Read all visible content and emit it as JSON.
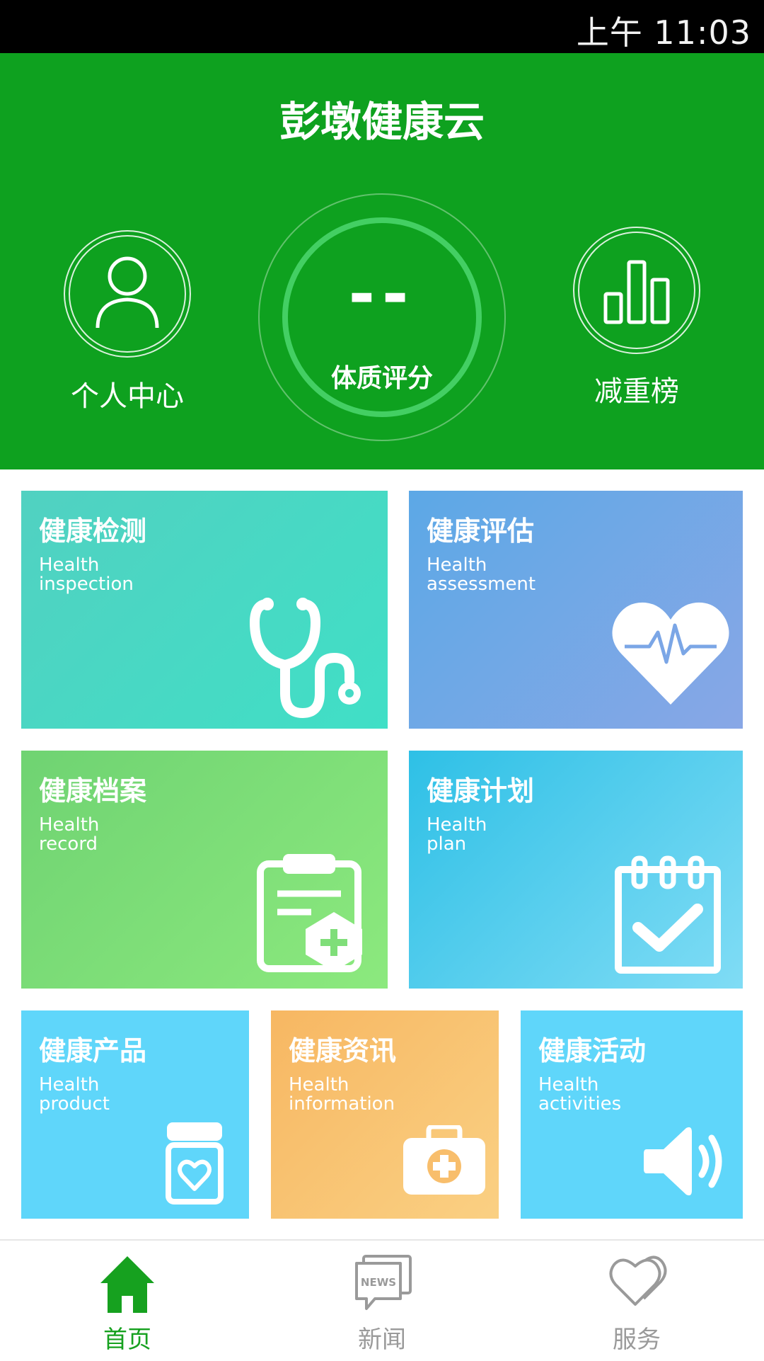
{
  "status_bar": {
    "time": "上午 11:03"
  },
  "header": {
    "app_title": "彭墩健康云",
    "nav": [
      {
        "label": "个人中心",
        "icon": "person-icon"
      },
      {
        "label": "体质评分",
        "value": "--"
      },
      {
        "label": "减重榜",
        "icon": "bar-chart-icon"
      }
    ]
  },
  "tiles": [
    {
      "title": "健康检测",
      "subtitle_line1": "Health",
      "subtitle_line2": "inspection",
      "icon": "stethoscope-icon",
      "colors": [
        "#51d1c1",
        "#40dfc6"
      ]
    },
    {
      "title": "健康评估",
      "subtitle_line1": "Health",
      "subtitle_line2": "assessment",
      "icon": "heart-pulse-icon",
      "colors": [
        "#5ca8e6",
        "#88a7e6"
      ]
    },
    {
      "title": "健康档案",
      "subtitle_line1": "Health",
      "subtitle_line2": "record",
      "icon": "clipboard-plus-icon",
      "colors": [
        "#6fd372",
        "#8ce97e"
      ]
    },
    {
      "title": "健康计划",
      "subtitle_line1": "Health",
      "subtitle_line2": "plan",
      "icon": "calendar-check-icon",
      "colors": [
        "#2ec0e6",
        "#80dcf5"
      ]
    },
    {
      "title": "健康产品",
      "subtitle_line1": "Health",
      "subtitle_line2": "product",
      "icon": "jar-heart-icon",
      "colors": [
        "#5fd6fa",
        "#5fd6fa"
      ]
    },
    {
      "title": "健康资讯",
      "subtitle_line1": "Health",
      "subtitle_line2": "information",
      "icon": "medkit-icon",
      "colors": [
        "#f7b762",
        "#fad083"
      ]
    },
    {
      "title": "健康活动",
      "subtitle_line1": "Health",
      "subtitle_line2": "activities",
      "icon": "speaker-icon",
      "colors": [
        "#5fd6fa",
        "#5fd6fa"
      ]
    }
  ],
  "bottom_nav": {
    "tabs": [
      {
        "label": "首页",
        "icon": "home-icon",
        "active": true
      },
      {
        "label": "新闻",
        "icon": "news-icon",
        "icon_text": "NEWS",
        "active": false
      },
      {
        "label": "服务",
        "icon": "hearts-icon",
        "active": false
      }
    ],
    "active_color": "#16a11f",
    "inactive_color": "#9a9a9a"
  }
}
